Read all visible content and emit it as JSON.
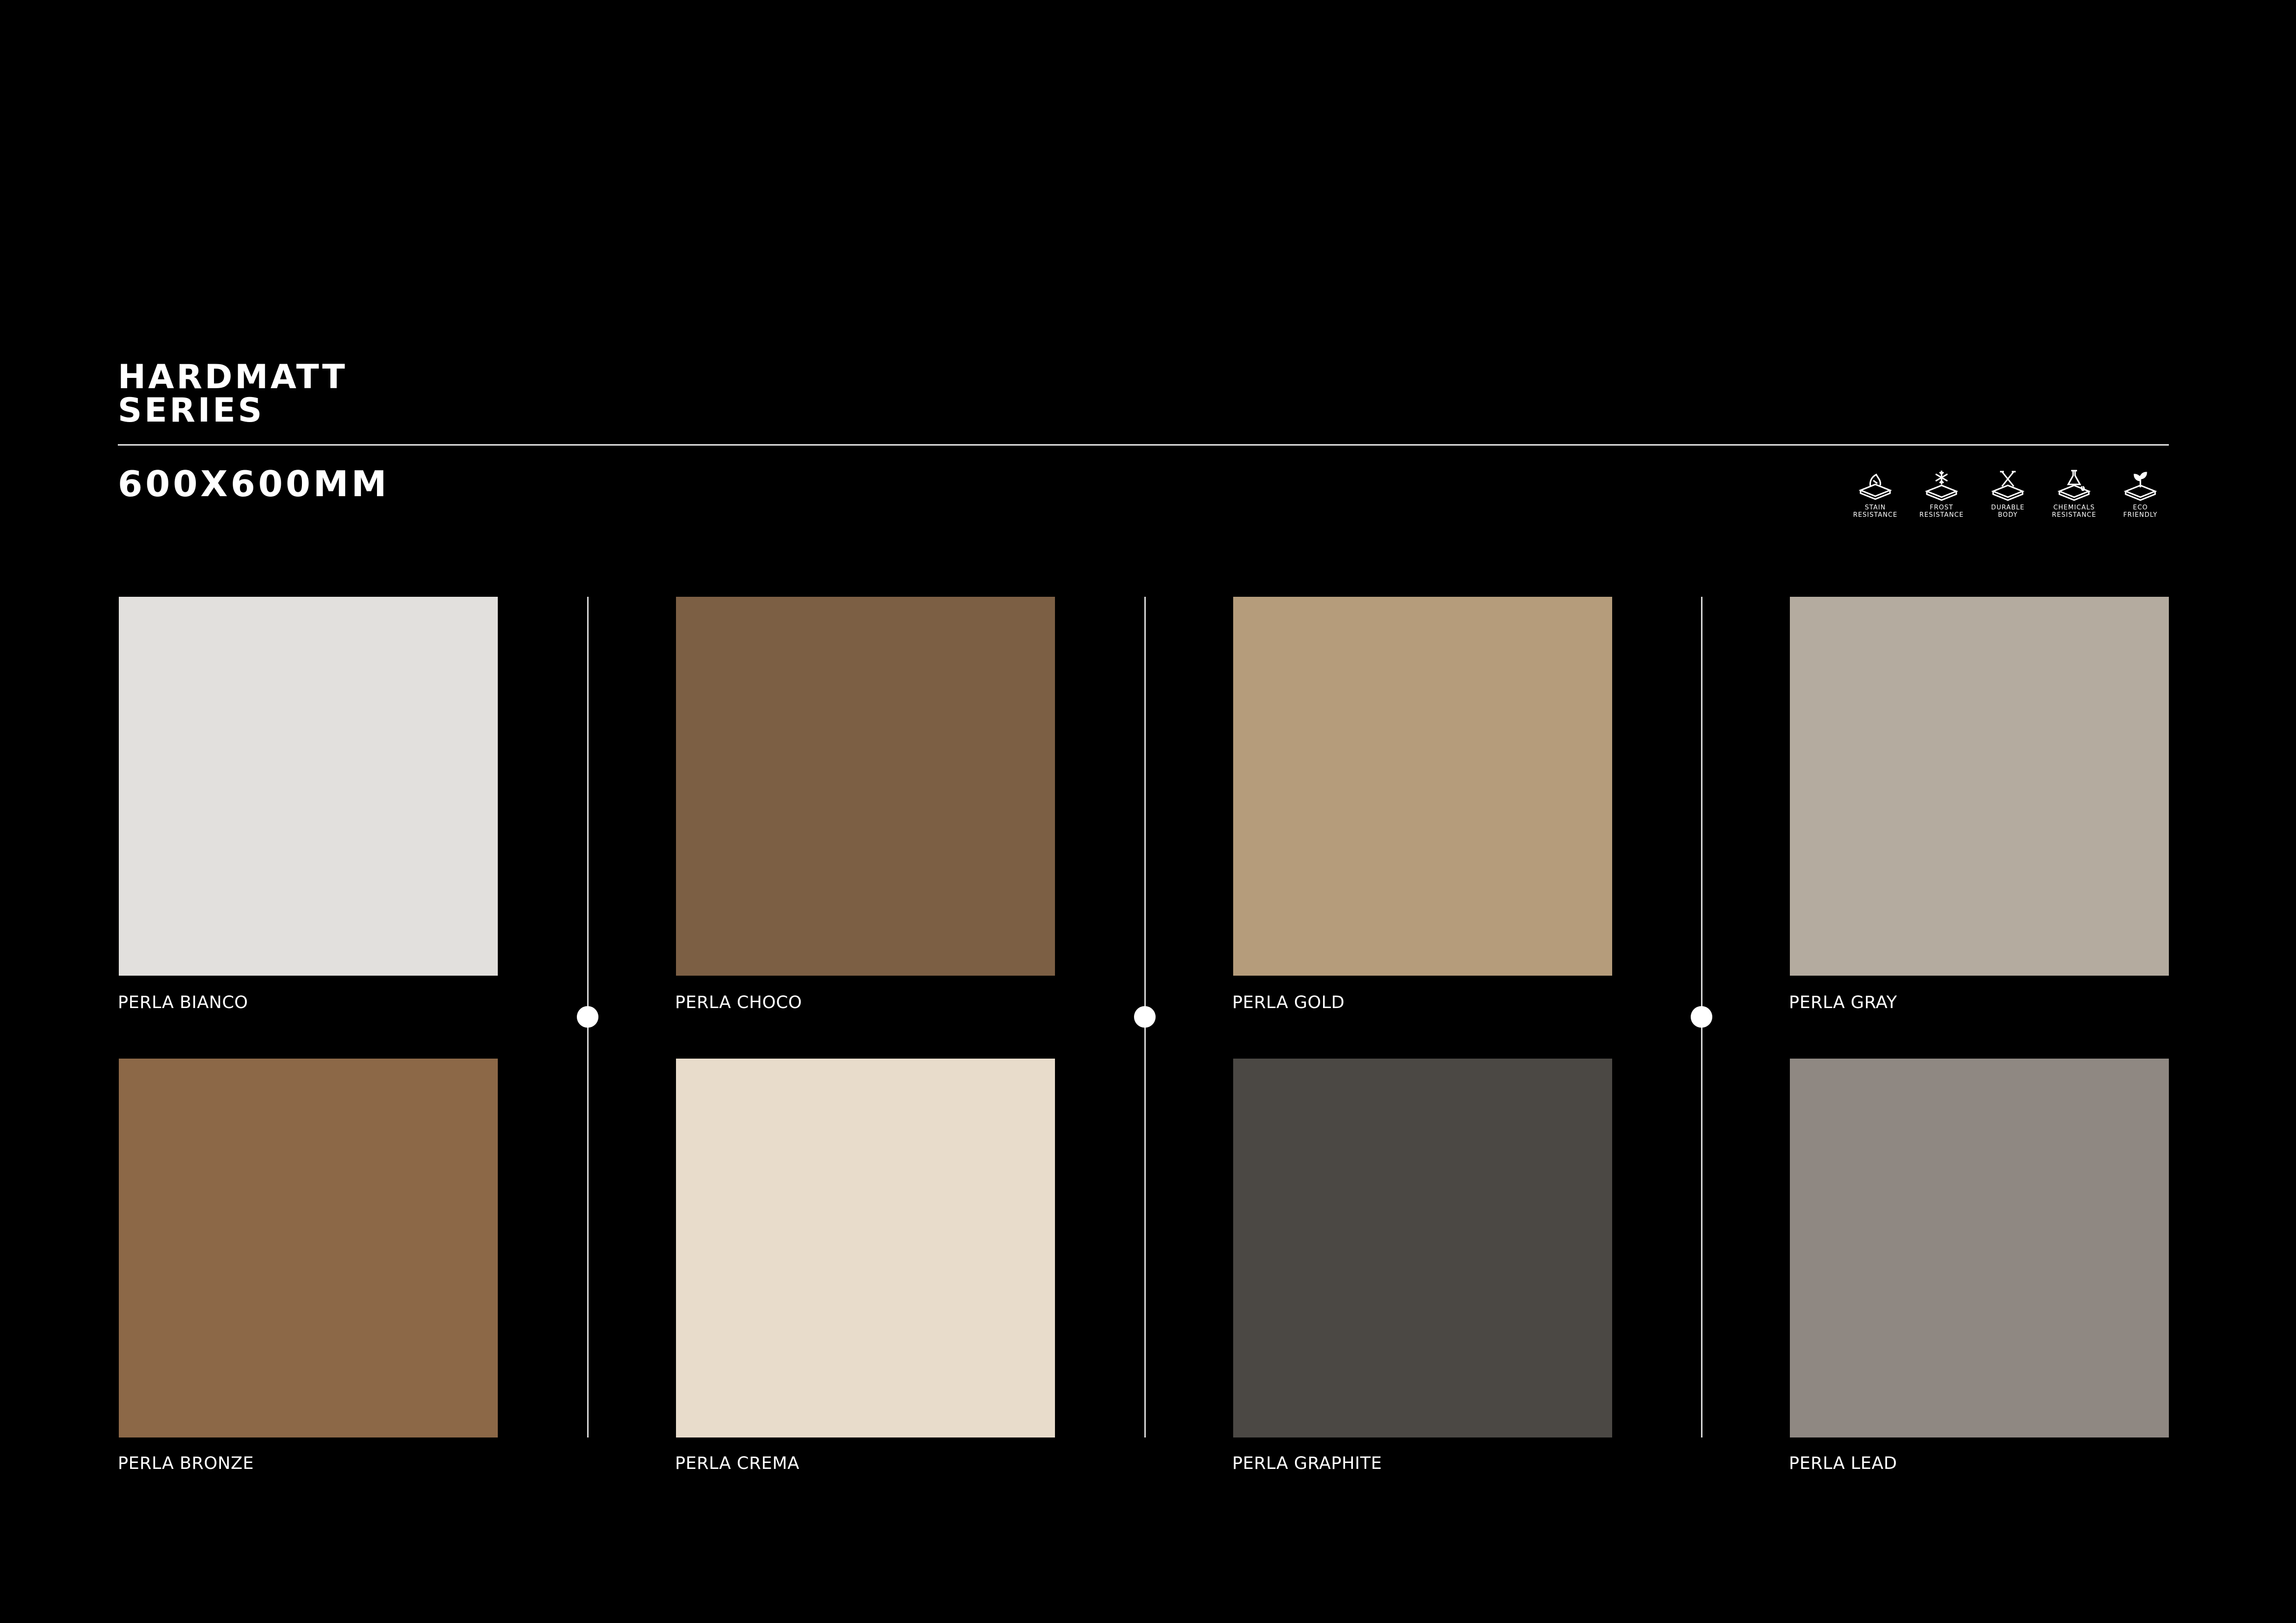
{
  "header": {
    "title_line1": "HARDMATT",
    "title_line2": "SERIES",
    "size": "600X600MM"
  },
  "features": [
    {
      "icon": "stain-resistance-icon",
      "label": "STAIN\nRESISTANCE"
    },
    {
      "icon": "frost-resistance-icon",
      "label": "FROST\nRESISTANCE"
    },
    {
      "icon": "durable-body-icon",
      "label": "DURABLE\nBODY"
    },
    {
      "icon": "chemicals-resistance-icon",
      "label": "CHEMICALS\nRESISTANCE"
    },
    {
      "icon": "eco-friendly-icon",
      "label": "ECO\nFRIENDLY"
    }
  ],
  "tiles": [
    {
      "name": "PERLA BIANCO",
      "color": "#e2e0dd"
    },
    {
      "name": "PERLA CHOCO",
      "color": "#7c5f44"
    },
    {
      "name": "PERLA GOLD",
      "color": "#b59c7b"
    },
    {
      "name": "PERLA GRAY",
      "color": "#b4ab9f"
    },
    {
      "name": "PERLA BRONZE",
      "color": "#8c6847"
    },
    {
      "name": "PERLA CREMA",
      "color": "#e8dccb"
    },
    {
      "name": "PERLA GRAPHITE",
      "color": "#4b4844"
    },
    {
      "name": "PERLA LEAD",
      "color": "#8f8882"
    }
  ]
}
